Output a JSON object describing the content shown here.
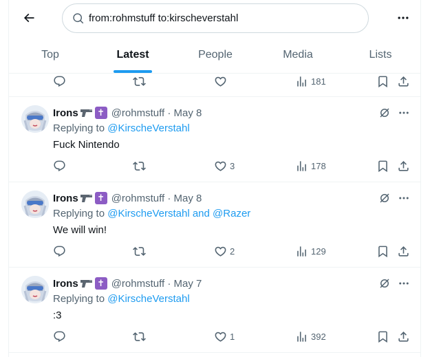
{
  "search": {
    "value": "from:rohmstuff to:kirscheverstahl"
  },
  "tabs": [
    {
      "label": "Top"
    },
    {
      "label": "Latest"
    },
    {
      "label": "People"
    },
    {
      "label": "Media"
    },
    {
      "label": "Lists"
    }
  ],
  "top_bar": {
    "views": "181"
  },
  "tweets": [
    {
      "name": "Irons",
      "handle_date": "@rohmstuff · May 8",
      "replying_prefix": "Replying to ",
      "mention_1": "@KirscheVerstahl",
      "mention_sep": "",
      "mention_2": "",
      "text": "Fuck Nintendo",
      "likes": "3",
      "views": "178"
    },
    {
      "name": "Irons",
      "handle_date": "@rohmstuff · May 8",
      "replying_prefix": "Replying to ",
      "mention_1": "@KirscheVerstahl",
      "mention_sep": " and ",
      "mention_2": "@Razer",
      "text": "We will win!",
      "likes": "2",
      "views": "129"
    },
    {
      "name": "Irons",
      "handle_date": "@rohmstuff · May 7",
      "replying_prefix": "Replying to ",
      "mention_1": "@KirscheVerstahl",
      "mention_sep": "",
      "mention_2": "",
      "text": ":3",
      "likes": "1",
      "views": "392"
    }
  ],
  "colors": {
    "accent": "#1d9bf0",
    "muted": "#536471",
    "text": "#0f1419",
    "border": "#eff3f4"
  }
}
